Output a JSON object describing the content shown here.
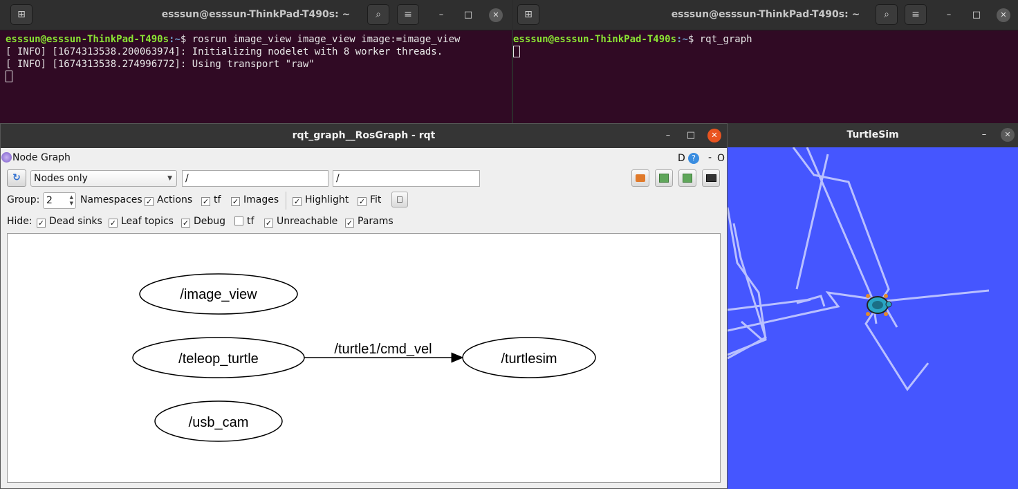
{
  "terminal_left": {
    "title": "esssun@esssun-ThinkPad-T490s: ~",
    "prompt_user": "esssun@esssun-ThinkPad-T490s",
    "prompt_path": ":~",
    "command": "$ rosrun image_view image_view image:=image_view",
    "lines": [
      "[ INFO] [1674313538.200063974]: Initializing nodelet with 8 worker threads.",
      "[ INFO] [1674313538.274996772]: Using transport \"raw\""
    ]
  },
  "terminal_right": {
    "title": "esssun@esssun-ThinkPad-T490s: ~",
    "prompt_user": "esssun@esssun-ThinkPad-T490s",
    "prompt_path": ":~",
    "command": "$ rqt_graph"
  },
  "window_controls": {
    "minimize": "–",
    "maximize": "□",
    "close": "✕"
  },
  "rqt": {
    "title": "rqt_graph__RosGraph - rqt",
    "plugin_title": "Node Graph",
    "plugin_buttons": {
      "d": "D",
      "help": "?",
      "dash": "-",
      "o": "O"
    },
    "mode_select": "Nodes only",
    "filter_1": "/",
    "filter_2": "/",
    "group_label": "Group:",
    "group_value": "2",
    "options": {
      "namespaces": "Namespaces",
      "actions": "Actions",
      "tf": "tf",
      "images": "Images",
      "highlight": "Highlight",
      "fit": "Fit"
    },
    "hide_label": "Hide:",
    "hide": {
      "dead_sinks": "Dead sinks",
      "leaf_topics": "Leaf topics",
      "debug": "Debug",
      "tf": "tf",
      "unreachable": "Unreachable",
      "params": "Params"
    },
    "graph": {
      "nodes": [
        "/image_view",
        "/teleop_turtle",
        "/turtlesim",
        "/usb_cam"
      ],
      "edge_label": "/turtle1/cmd_vel"
    }
  },
  "turtlesim": {
    "title": "TurtleSim",
    "background": "#4556ff"
  }
}
